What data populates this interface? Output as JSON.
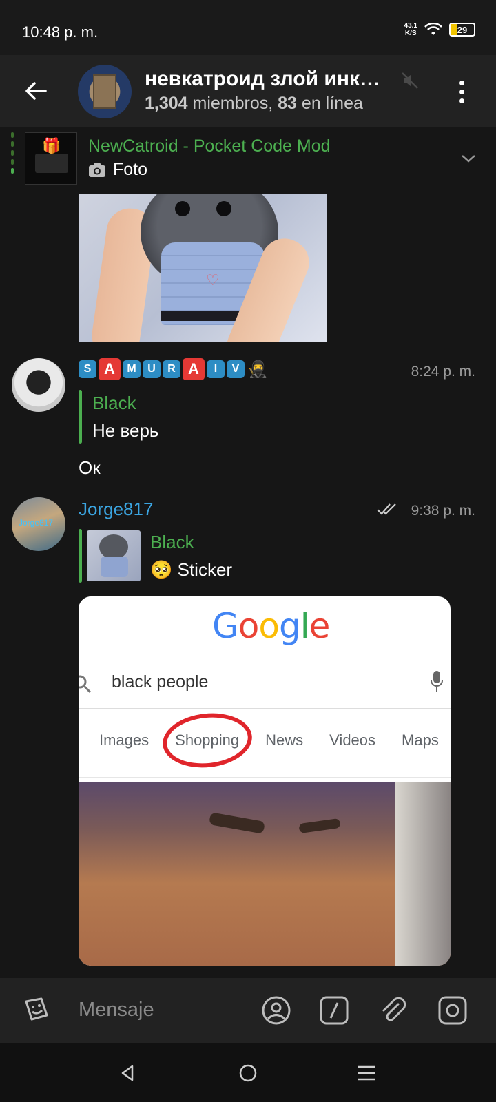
{
  "status": {
    "time": "10:48 p. m.",
    "net_speed_value": "43.1",
    "net_speed_unit": "K/S",
    "battery": "29"
  },
  "header": {
    "title": "невкатроид злой инк…",
    "members_count": "1,304",
    "members_label": "miembros,",
    "online_count": "83",
    "online_label": "en línea"
  },
  "pinned": {
    "title": "NewCatroid - Pocket Code Mod",
    "subtitle": "Foto"
  },
  "messages": [
    {
      "sender_badges": [
        "S",
        "A",
        "M",
        "U",
        "R",
        "A",
        "I",
        "V"
      ],
      "time": "8:24 p. m.",
      "reply_name": "Black",
      "reply_text": "Не верь",
      "text": "Ок"
    },
    {
      "sender": "Jorge817",
      "avatar_text": "Jorge817",
      "time": "9:38 p. m.",
      "reply_name": "Black",
      "reply_text": "🥺 Sticker",
      "image": {
        "logo": [
          "G",
          "o",
          "o",
          "g",
          "l",
          "e"
        ],
        "query": "black people",
        "tabs": [
          "Images",
          "Shopping",
          "News",
          "Videos",
          "Maps"
        ]
      }
    }
  ],
  "input": {
    "placeholder": "Mensaje"
  },
  "colors": {
    "background": "#161616",
    "header": "#222222",
    "accent_green": "#4caf50",
    "accent_blue": "#3ba4e0"
  }
}
